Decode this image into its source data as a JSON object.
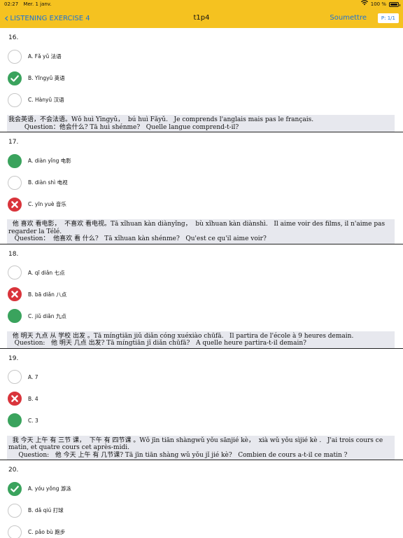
{
  "status": {
    "time": "02:27",
    "date": "Mer. 1 janv.",
    "battery": "100 %"
  },
  "nav": {
    "back_label": "LISTENING EXERCISE 4",
    "title": "t1p4",
    "submit_label": "Soumettre",
    "page_label": "P: 1/1"
  },
  "questions": [
    {
      "number": "16.",
      "options": [
        {
          "label": "A. Fǎ yǔ 法语",
          "state": "empty"
        },
        {
          "label": "B. Yīngyǔ 英语",
          "state": "selected-correct"
        },
        {
          "label": "C. Hànyǔ 汉语",
          "state": "empty"
        }
      ],
      "explanation": "我会英语，不会法语。Wǒ huì Yīngyǔ，  bú huì Fǎyǔ.   Je comprends l'anglais mais pas le français.\n        Question：他会什么? Tā huì shénme?   Quelle langue comprend-t-il?"
    },
    {
      "number": "17.",
      "options": [
        {
          "label": "A. diàn yǐng 电影",
          "state": "correct"
        },
        {
          "label": "B. diàn shì 电视",
          "state": "empty"
        },
        {
          "label": "C. yīn yuè 音乐",
          "state": "wrong"
        }
      ],
      "explanation": "  他 喜欢 看电影，  不喜欢 看电视。Tā xǐhuan kàn diànyǐng，  bù xǐhuan kàn diànshì.   Il aime voir des films, il n'aime pas regarder la Télé.\n   Question：  他喜欢 看 什么?   Tā xǐhuan kàn shénme?   Qu'est ce qu'il aime voir?"
    },
    {
      "number": "18.",
      "options": [
        {
          "label": "A. qī diǎn 七点",
          "state": "empty"
        },
        {
          "label": "B. bā diǎn 八点",
          "state": "wrong"
        },
        {
          "label": "C. jiǔ diǎn 九点",
          "state": "correct"
        }
      ],
      "explanation": "  他 明天 九点 从 学校 出发 。Tā míngtiān jiǔ diǎn cóng xuéxiào chūfā.   Il partira de l'école à 9 heures demain.\n   Question:   他 明天 几点 出发? Tā míngtiān jǐ diǎn chūfā?   A quelle heure partira-t-il demain?"
    },
    {
      "number": "19.",
      "options": [
        {
          "label": "A. 7",
          "state": "empty"
        },
        {
          "label": "B. 4",
          "state": "wrong"
        },
        {
          "label": "C. 3",
          "state": "correct"
        }
      ],
      "explanation": "  我 今天 上午 有 三节 课，  下午 有 四节课 。Wǒ jīn tiān shàngwǔ yǒu sānjié kè，  xià wǔ yǒu sìjié kè .   J'ai trois cours ce matin, et quatre cours cet après-midi.\n     Question:   他 今天 上午 有 几节课? Tā jīn tiān shàng wǔ yǒu jǐ jié kè?   Combien de cours a-t-il ce matin ?"
    },
    {
      "number": "20.",
      "options": [
        {
          "label": "A. yóu yǒng 游泳",
          "state": "selected-correct"
        },
        {
          "label": "B. dǎ qiú 打球",
          "state": "empty"
        },
        {
          "label": "C. pǎo bù 跑步",
          "state": "empty"
        }
      ],
      "explanation": ""
    }
  ],
  "colors": {
    "bar": "#f5c220",
    "link": "#1a73d9",
    "correct": "#3aa35d",
    "wrong": "#d9343b",
    "explanation_bg": "#e7e8ee"
  }
}
